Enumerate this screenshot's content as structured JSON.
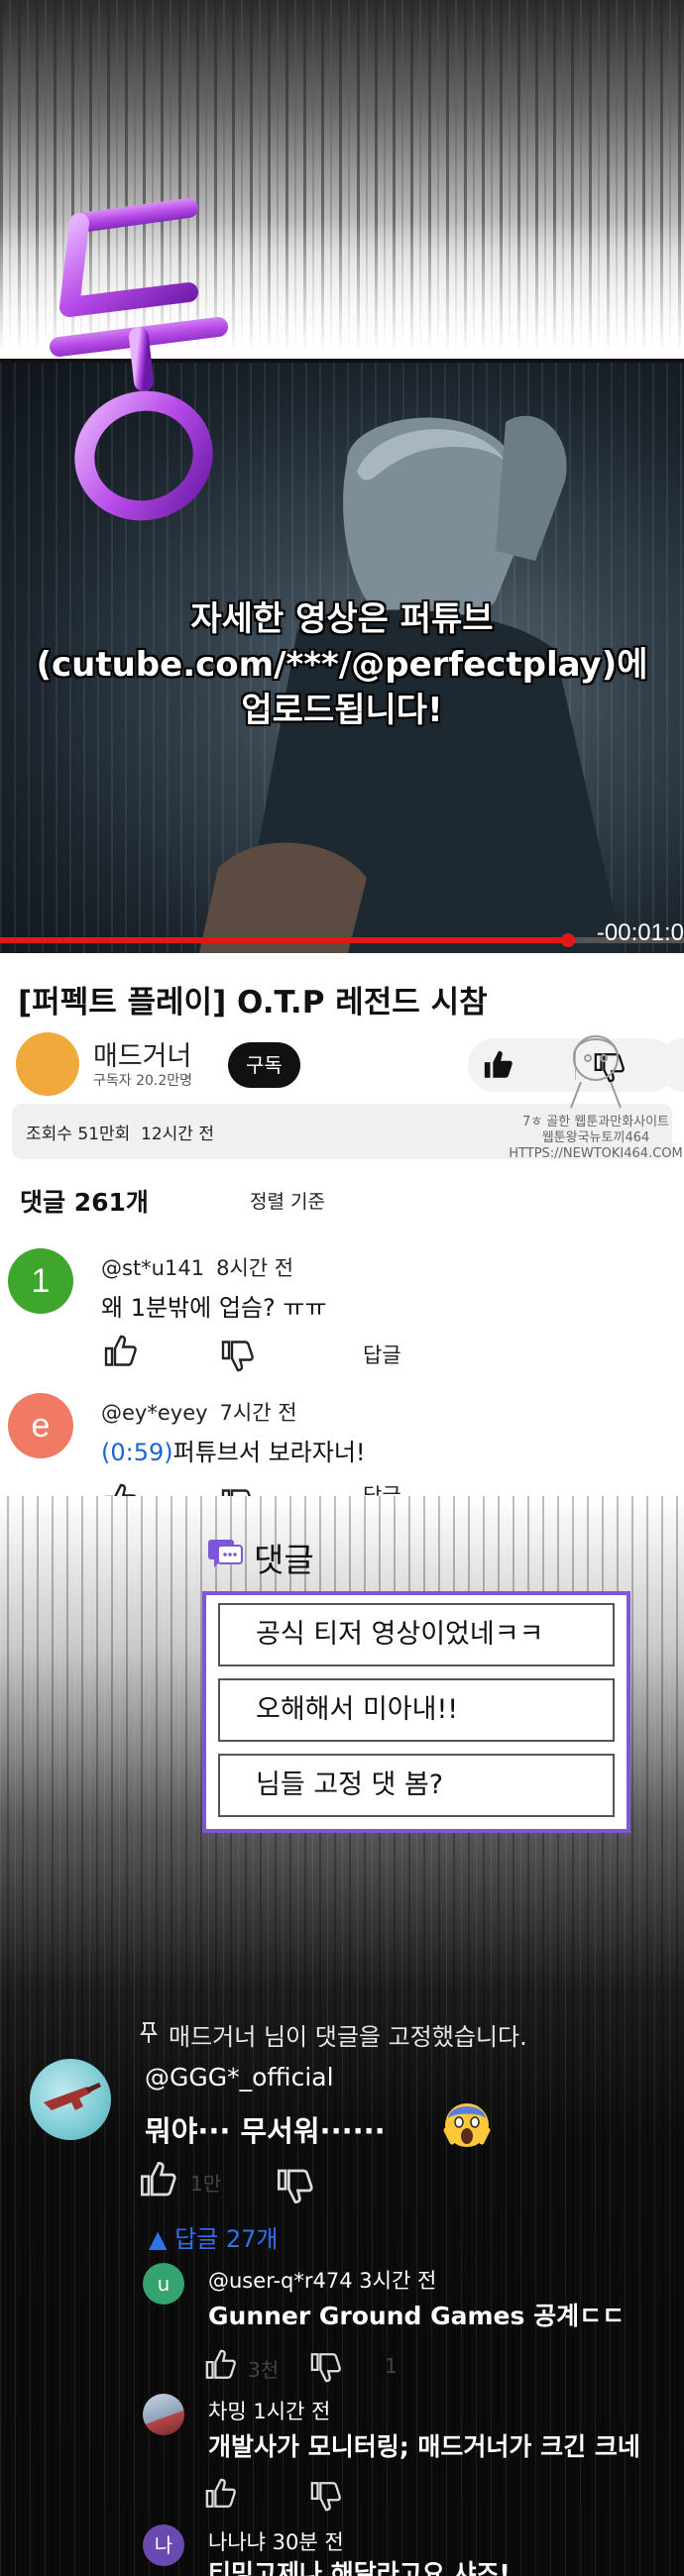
{
  "sfx": {
    "text": "둥",
    "color": "#b84be8"
  },
  "video": {
    "caption_lines": [
      "자세한 영상은 퍼튜브",
      "(cutube.com/***/@perfectplay)에",
      "업로드됩니다!"
    ],
    "timecode": "-00:01:0",
    "progress_fraction": 0.83,
    "progress_color": "#e01818"
  },
  "info": {
    "title": "[퍼펙트 플레이] O.T.P 레전드 시참",
    "channel_name": "매드거너",
    "channel_subs": "구독자 20.2만명",
    "subscribe_label": "구독",
    "views": "조회수 51만회",
    "posted": "12시간 전",
    "watermark": [
      "7ㅎ 골한 웹툰과만화사이트",
      "웹툰왕국뉴토끼464",
      "HTTPS://NEWTOKI464.COM"
    ]
  },
  "comments_header": {
    "count_label": "댓글 261개",
    "sort_label": "정렬 기준"
  },
  "comments": [
    {
      "avatar_letter": "1",
      "avatar_color": "#3ea62d",
      "user": "@st*u141",
      "time": "8시간 전",
      "text": "왜 1분밖에 업슴? ㅠㅠ",
      "reply_label": "답글"
    },
    {
      "avatar_letter": "e",
      "avatar_color": "#f07a63",
      "user": "@ey*eyey",
      "time": "7시간 전",
      "timestamp": "(0:59)",
      "text": "퍼튜브서 보라자너!",
      "reply_label": "답글"
    }
  ],
  "reply_panel": {
    "title": "댓글",
    "accent": "#7d57d6",
    "options": [
      "공식 티저 영상이었네ㅋㅋ",
      "오해해서 미아내!!",
      "님들 고정 댓 봄?"
    ]
  },
  "pinned": {
    "note": "매드거너 님이 댓글을 고정했습니다.",
    "user": "@GGG*_official",
    "text": "뭐야··· 무서워······",
    "like_count": "1만",
    "replies_toggle": "▲ 답글 27개"
  },
  "replies": [
    {
      "avatar_letter": "u",
      "avatar_color": "#35a36f",
      "user": "@user-q*r474",
      "time": "3시간 전",
      "text": "Gunner Ground Games 공계ㄷㄷ",
      "like_count": "3천",
      "reply_count": "1"
    },
    {
      "avatar_letter": "",
      "avatar_color": "#7f8fa0",
      "user": "차밍",
      "time": "1시간 전",
      "text": "개발사가 모니터링; 매드거너가 크긴 크네",
      "like_count": ""
    },
    {
      "avatar_letter": "나",
      "avatar_color": "#6a4ab0",
      "user": "나나냐",
      "time": "30분 전",
      "text": "티밍고제나 해달라고요 샤즈!"
    }
  ]
}
